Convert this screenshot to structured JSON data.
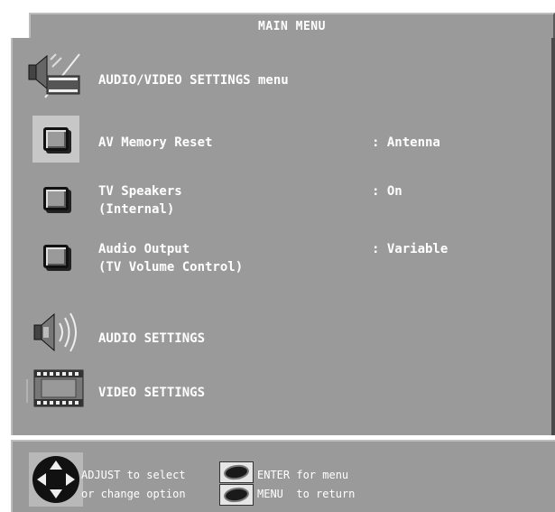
{
  "title": "MAIN MENU",
  "menu": {
    "header": "AUDIO/VIDEO SETTINGS menu",
    "items": [
      {
        "label": "AV Memory Reset",
        "value": ": Antenna",
        "selected": true
      },
      {
        "label": "TV Speakers\n(Internal)",
        "value": ": On",
        "selected": false
      },
      {
        "label": "Audio Output\n(TV Volume Control)",
        "value": ": Variable",
        "selected": false
      }
    ],
    "audio_settings": "AUDIO SETTINGS",
    "video_settings": "VIDEO SETTINGS"
  },
  "footer": {
    "adjust_line1": "ADJUST to select",
    "adjust_line2": "or change option",
    "enter_text": "ENTER for menu",
    "menu_text": "MENU  to return"
  },
  "icons": {
    "header_icon": "speaker-film-icon",
    "audio_icon": "speaker-sound-icon",
    "video_icon": "film-strip-icon",
    "dpad_icon": "dpad-icon",
    "enter_icon": "enter-button-icon",
    "menu_icon": "menu-button-icon"
  },
  "colors": {
    "panel": "#9a9a9a",
    "text": "#ffffff",
    "selected_highlight": "#c7c7c7"
  }
}
